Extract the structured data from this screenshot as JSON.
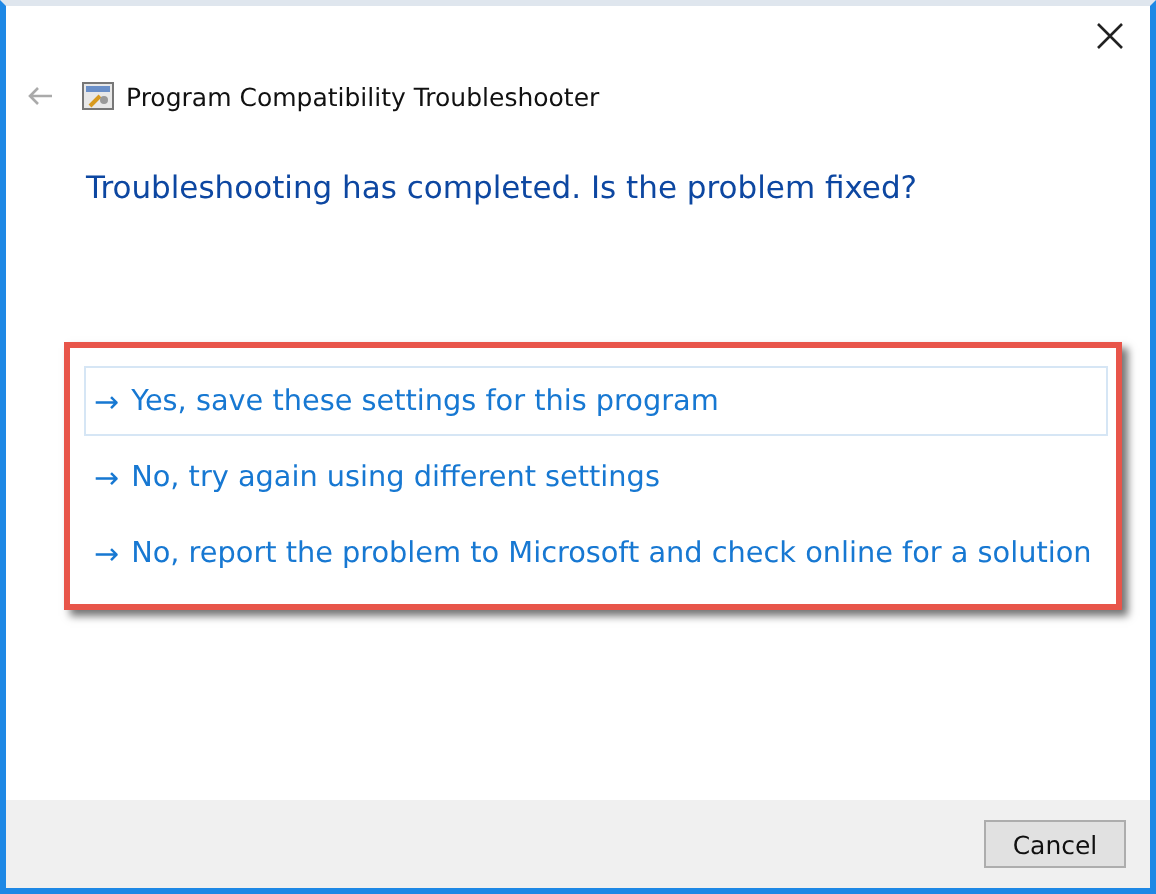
{
  "window": {
    "title": "Program Compatibility Troubleshooter"
  },
  "heading": "Troubleshooting has completed.  Is the problem fixed?",
  "options": [
    {
      "arrow": "→",
      "label": "Yes, save these settings for this program",
      "selected": true
    },
    {
      "arrow": "→",
      "label": "No, try again using different settings",
      "selected": false
    },
    {
      "arrow": "→",
      "label": "No, report the problem to Microsoft and check online for a solution",
      "selected": false
    }
  ],
  "buttons": [
    "Cancel"
  ]
}
